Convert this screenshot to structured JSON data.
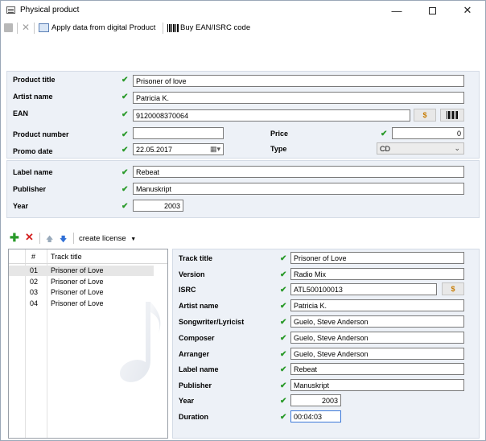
{
  "window": {
    "title": "Physical product"
  },
  "toolbar": {
    "apply_label": "Apply data from digital Product",
    "buy_label": "Buy EAN/ISRC code"
  },
  "product": {
    "title_label": "Product title",
    "title_value": "Prisoner of love",
    "artist_label": "Artist name",
    "artist_value": "Patricia K.",
    "ean_label": "EAN",
    "ean_value": "9120008370064",
    "number_label": "Product number",
    "number_value": "",
    "price_label": "Price",
    "price_value": "0",
    "promo_label": "Promo date",
    "promo_value": "22.05.2017",
    "type_label": "Type",
    "type_value": "CD",
    "dollar": "$"
  },
  "label_info": {
    "label_label": "Label name",
    "label_value": "Rebeat",
    "publisher_label": "Publisher",
    "publisher_value": "Manuskript",
    "year_label": "Year",
    "year_value": "2003"
  },
  "tracks_toolbar": {
    "license_label": "create license"
  },
  "track_list": {
    "col_num": "#",
    "col_title": "Track title",
    "rows": [
      {
        "num": "01",
        "title": "Prisoner of Love"
      },
      {
        "num": "02",
        "title": "Prisoner of Love"
      },
      {
        "num": "03",
        "title": "Prisoner of Love"
      },
      {
        "num": "04",
        "title": "Prisoner of Love"
      }
    ]
  },
  "track_detail": {
    "title_label": "Track title",
    "title_value": "Prisoner of Love",
    "version_label": "Version",
    "version_value": "Radio Mix",
    "isrc_label": "ISRC",
    "isrc_value": "ATL500100013",
    "artist_label": "Artist name",
    "artist_value": "Patricia K.",
    "songwriter_label": "Songwriter/Lyricist",
    "songwriter_value": "Guelo, Steve Anderson",
    "composer_label": "Composer",
    "composer_value": "Guelo, Steve Anderson",
    "arranger_label": "Arranger",
    "arranger_value": "Guelo, Steve Anderson",
    "label_label": "Label name",
    "label_value": "Rebeat",
    "publisher_label": "Publisher",
    "publisher_value": "Manuskript",
    "year_label": "Year",
    "year_value": "2003",
    "duration_label": "Duration",
    "duration_value": "00:04:03"
  },
  "colors": {
    "check": "#2a9a2a",
    "panel": "#edf1f7",
    "dollar": "#c77b00"
  }
}
